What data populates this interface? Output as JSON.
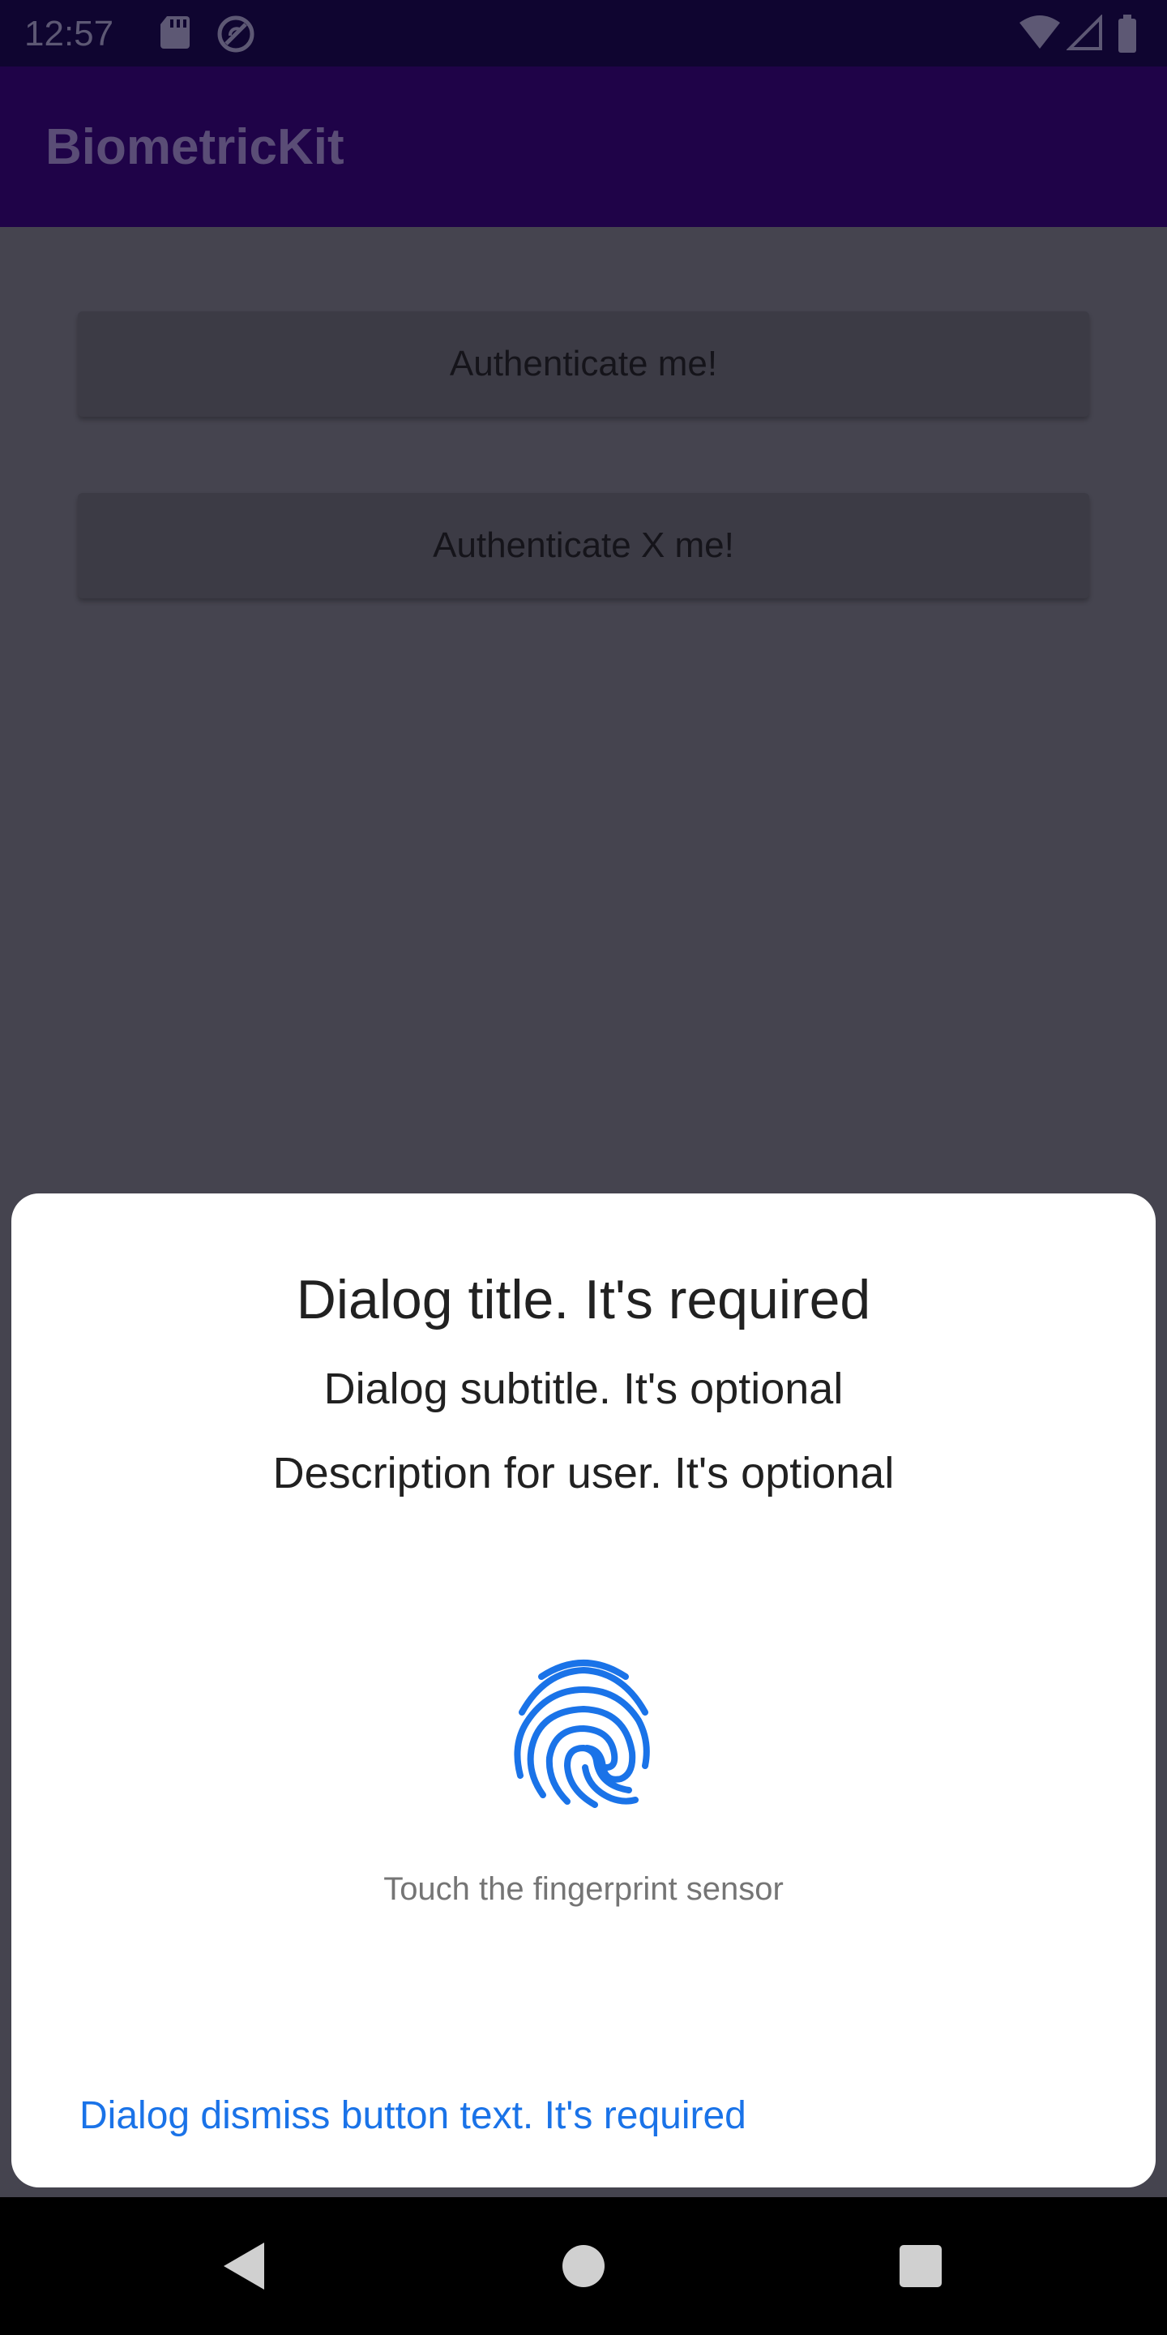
{
  "status_bar": {
    "time": "12:57",
    "icons": [
      "sd-card-icon",
      "do-not-disturb-icon",
      "wifi-icon",
      "signal-icon",
      "battery-icon"
    ]
  },
  "app_bar": {
    "title": "BiometricKit"
  },
  "main": {
    "buttons": [
      {
        "label": "Authenticate me!"
      },
      {
        "label": "Authenticate X me!"
      }
    ]
  },
  "dialog": {
    "title": "Dialog title. It's required",
    "subtitle": "Dialog subtitle. It's optional",
    "description": "Description for user. It's optional",
    "icon": "fingerprint-icon",
    "hint": "Touch the fingerprint sensor",
    "dismiss_label": "Dialog dismiss button text. It's required"
  },
  "nav_bar": {
    "icons": [
      "back-icon",
      "home-icon",
      "recents-icon"
    ]
  },
  "colors": {
    "accent": "#1a73e8",
    "app_bar": "#1f0348",
    "scrim": "#45444f"
  }
}
